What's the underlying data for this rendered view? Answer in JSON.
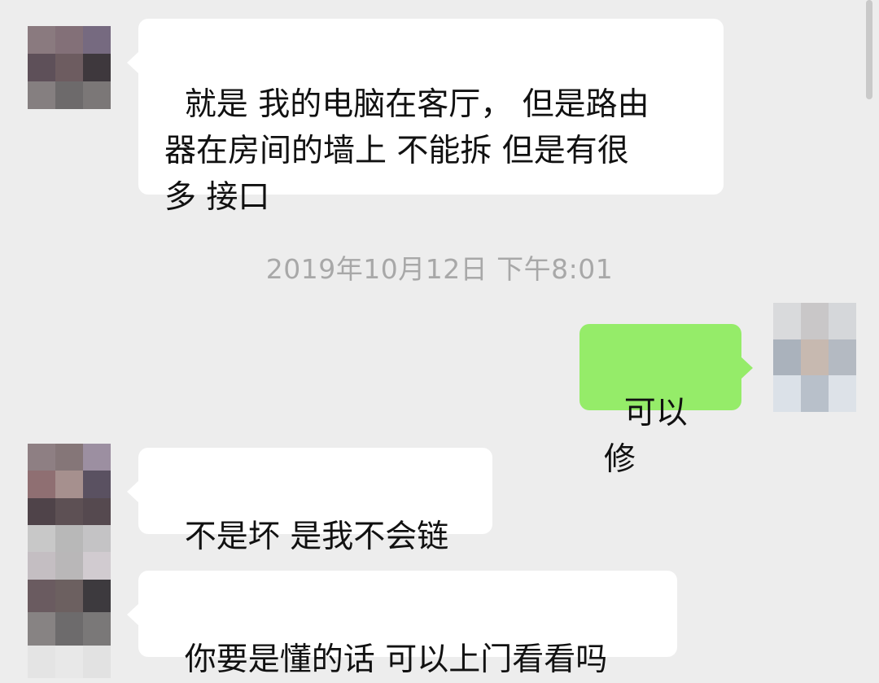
{
  "chat": {
    "messages": [
      {
        "id": "m1",
        "direction": "incoming",
        "text": "就是 我的电脑在客厅， 但是路由\n器在房间的墙上 不能拆 但是有很\n多 接口"
      },
      {
        "id": "m2",
        "direction": "outgoing",
        "text": "可以修"
      },
      {
        "id": "m3",
        "direction": "incoming",
        "text": "不是坏 是我不会链"
      },
      {
        "id": "m4",
        "direction": "incoming",
        "text": "你要是懂的话 可以上门看看吗"
      }
    ],
    "timestamp": "2019年10月12日 下午8:01"
  },
  "avatars": {
    "contact_1": [
      "#8a7a7f",
      "#837078",
      "#766a80",
      "#5e5059",
      "#6d5c60",
      "#3e383d",
      "#857f80",
      "#6d6a6b",
      "#7b7777"
    ],
    "self": [
      "#d9dadc",
      "#c9c7c8",
      "#d5d7da",
      "#aab2bc",
      "#c7b9b0",
      "#b4bac2",
      "#dbe1e8",
      "#b8c0ca",
      "#dde2e8"
    ],
    "contact_2": [
      "#8e7f83",
      "#857678",
      "#9c8fa1",
      "#8f6f72",
      "#a6908e",
      "#5a5161",
      "#4f4349",
      "#5d5054",
      "#55494f"
    ],
    "contact_3": [
      "#c8c8c8",
      "#b8b8b8",
      "#c4c3c5",
      "#c4bec2",
      "#b9b7b8",
      "#d1cbd0",
      "#8d7d80",
      "#817579",
      "#756c80"
    ],
    "contact_4": [
      "#6a5b60",
      "#6c6060",
      "#3d3a3e",
      "#878383",
      "#6d6b6c",
      "#7a7878",
      "#e4e4e4",
      "#e8e8e8",
      "#e2e2e2"
    ]
  },
  "colors": {
    "background": "#ededed",
    "incoming_bubble": "#ffffff",
    "outgoing_bubble": "#95ec69",
    "timestamp_text": "#a8a8a8"
  }
}
